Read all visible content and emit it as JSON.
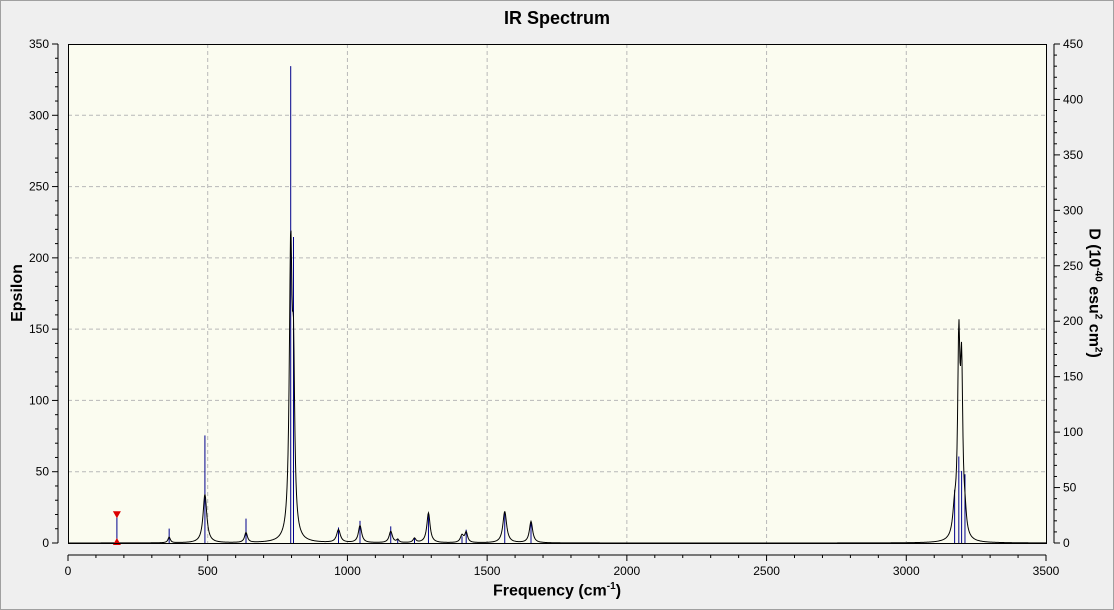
{
  "chart_data": {
    "type": "line",
    "title": "IR Spectrum",
    "xlabel": {
      "main": "Frequency (cm",
      "sup": "-1",
      "tail": ")"
    },
    "ylabel": "Epsilon",
    "y2label": {
      "p1": "D (10",
      "sup1": "-40",
      "p2": " esu",
      "sup2": "2",
      "p3": " cm",
      "sup3": "2",
      "p4": ")"
    },
    "xlim": [
      0,
      3500
    ],
    "ylim": [
      0,
      350
    ],
    "y2lim": [
      0,
      450
    ],
    "xticks": [
      0,
      500,
      1000,
      1500,
      2000,
      2500,
      3000,
      3500
    ],
    "yticks": [
      0,
      50,
      100,
      150,
      200,
      250,
      300,
      350
    ],
    "y2ticks": [
      0,
      50,
      100,
      150,
      200,
      250,
      300,
      350,
      400,
      450
    ],
    "grid": true,
    "colors": {
      "background": "#fbfcf0",
      "spectrum": "#000000",
      "sticks": "#00008b",
      "marker": "#dd0000",
      "grid": "#b8b8b8"
    },
    "series": [
      {
        "values": [
          {
            "x": 175,
            "epsilon": 0.5,
            "width": 3
          },
          {
            "x": 362,
            "epsilon": 4,
            "width": 5
          },
          {
            "x": 490,
            "epsilon": 34,
            "width": 8
          },
          {
            "x": 637,
            "epsilon": 7,
            "width": 6
          },
          {
            "x": 797,
            "epsilon": 200,
            "width": 6
          },
          {
            "x": 807,
            "epsilon": 105,
            "width": 5
          },
          {
            "x": 968,
            "epsilon": 9,
            "width": 8
          },
          {
            "x": 1045,
            "epsilon": 12,
            "width": 7
          },
          {
            "x": 1155,
            "epsilon": 8,
            "width": 7
          },
          {
            "x": 1180,
            "epsilon": 2,
            "width": 5
          },
          {
            "x": 1240,
            "epsilon": 3,
            "width": 6
          },
          {
            "x": 1290,
            "epsilon": 21,
            "width": 7
          },
          {
            "x": 1410,
            "epsilon": 5,
            "width": 7
          },
          {
            "x": 1425,
            "epsilon": 7,
            "width": 6
          },
          {
            "x": 1563,
            "epsilon": 22,
            "width": 8
          },
          {
            "x": 1657,
            "epsilon": 15,
            "width": 7
          },
          {
            "x": 3173,
            "epsilon": 18,
            "width": 8
          },
          {
            "x": 3188,
            "epsilon": 130,
            "width": 5
          },
          {
            "x": 3198,
            "epsilon": 110,
            "width": 5
          },
          {
            "x": 3210,
            "epsilon": 12,
            "width": 6
          }
        ]
      },
      {
        "values": [
          {
            "x": 175,
            "d": 25
          },
          {
            "x": 362,
            "d": 13
          },
          {
            "x": 490,
            "d": 97
          },
          {
            "x": 637,
            "d": 22
          },
          {
            "x": 797,
            "d": 430
          },
          {
            "x": 807,
            "d": 276
          },
          {
            "x": 968,
            "d": 14
          },
          {
            "x": 1045,
            "d": 20
          },
          {
            "x": 1155,
            "d": 15
          },
          {
            "x": 1180,
            "d": 4
          },
          {
            "x": 1240,
            "d": 5
          },
          {
            "x": 1290,
            "d": 27
          },
          {
            "x": 1410,
            "d": 6
          },
          {
            "x": 1425,
            "d": 12
          },
          {
            "x": 1563,
            "d": 27
          },
          {
            "x": 1657,
            "d": 18
          },
          {
            "x": 3173,
            "d": 48
          },
          {
            "x": 3188,
            "d": 78
          },
          {
            "x": 3198,
            "d": 65
          },
          {
            "x": 3210,
            "d": 62
          }
        ]
      }
    ],
    "marker_x": 175
  }
}
